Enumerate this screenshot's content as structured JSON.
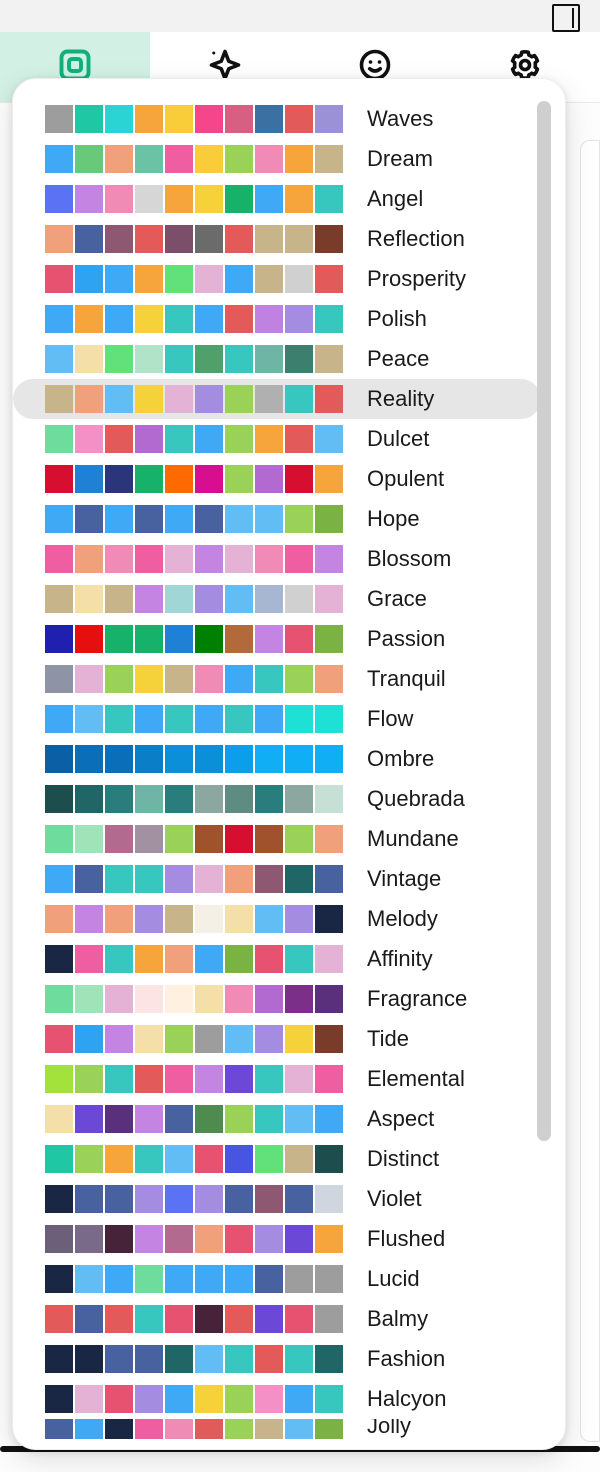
{
  "selected_palette": "Reality",
  "palettes": [
    {
      "name": "Waves",
      "colors": [
        "#9d9d9d",
        "#1fc7a4",
        "#2ad4d4",
        "#f6a53c",
        "#f9cc3a",
        "#f5458b",
        "#d65f82",
        "#3b70a3",
        "#e25a5a",
        "#9b91d6"
      ]
    },
    {
      "name": "Dream",
      "colors": [
        "#3fa9f5",
        "#67c979",
        "#f0a07a",
        "#6bc3a6",
        "#ee5ea0",
        "#f9cc3a",
        "#9ad159",
        "#f08bb5",
        "#f6a53c",
        "#c7b48b"
      ]
    },
    {
      "name": "Angel",
      "colors": [
        "#5b72f5",
        "#c485e2",
        "#f08bb5",
        "#d6d6d6",
        "#f6a53c",
        "#f5d23a",
        "#17b26a",
        "#3fa9f5",
        "#f6a53c",
        "#37c7bf"
      ]
    },
    {
      "name": "Reflection",
      "colors": [
        "#f0a07a",
        "#47629e",
        "#8e5772",
        "#e25a5a",
        "#7b4f6a",
        "#6b6b6b",
        "#e25a5a",
        "#c7b48b",
        "#c7b48b",
        "#7a3c2a"
      ]
    },
    {
      "name": "Prosperity",
      "colors": [
        "#e65270",
        "#2ea3f2",
        "#3fa9f5",
        "#f6a53c",
        "#62e07a",
        "#e4b2d5",
        "#3fa9f5",
        "#c7b48b",
        "#d0d0d0",
        "#e25a5a"
      ]
    },
    {
      "name": "Polish",
      "colors": [
        "#3fa9f5",
        "#f6a53c",
        "#3fa9f5",
        "#f5d23a",
        "#37c7bf",
        "#3fa9f5",
        "#e25a5a",
        "#c082e0",
        "#a48de0",
        "#37c7bf"
      ]
    },
    {
      "name": "Peace",
      "colors": [
        "#62bdf5",
        "#f5dfa8",
        "#62e07a",
        "#b1e3c9",
        "#37c7bf",
        "#4fa06b",
        "#37c7bf",
        "#6fb5a6",
        "#3d7f6f",
        "#c7b48b"
      ]
    },
    {
      "name": "Reality",
      "colors": [
        "#c7b48b",
        "#f0a07a",
        "#62bdf5",
        "#f5d23a",
        "#e4b2d5",
        "#a48de0",
        "#9ad159",
        "#b0b0b0",
        "#37c7bf",
        "#e25a5a"
      ]
    },
    {
      "name": "Dulcet",
      "colors": [
        "#6edc9c",
        "#f590c7",
        "#e25a5a",
        "#b26ad1",
        "#37c7bf",
        "#3fa9f5",
        "#9ad159",
        "#f6a53c",
        "#e25a5a",
        "#62bdf5"
      ]
    },
    {
      "name": "Opulent",
      "colors": [
        "#d60e2f",
        "#1f81d6",
        "#2b357a",
        "#17b26a",
        "#ff6a00",
        "#d60e8f",
        "#9ad159",
        "#b26ad1",
        "#d60e2f",
        "#f6a53c"
      ]
    },
    {
      "name": "Hope",
      "colors": [
        "#3fa9f5",
        "#47629e",
        "#3fa9f5",
        "#47629e",
        "#3fa9f5",
        "#47629e",
        "#62bdf5",
        "#62bdf5",
        "#9ad159",
        "#7ab344"
      ]
    },
    {
      "name": "Blossom",
      "colors": [
        "#ee5ea0",
        "#f0a07a",
        "#f08bb5",
        "#ee5ea0",
        "#e4b2d5",
        "#c485e2",
        "#e4b2d5",
        "#f08bb5",
        "#ee5ea0",
        "#c485e2"
      ]
    },
    {
      "name": "Grace",
      "colors": [
        "#c7b48b",
        "#f5dfa8",
        "#c7b48b",
        "#c485e2",
        "#a0d6d6",
        "#a48de0",
        "#62bdf5",
        "#a7b6d1",
        "#d0d0d0",
        "#e4b2d5"
      ]
    },
    {
      "name": "Passion",
      "colors": [
        "#1f1fb0",
        "#e60e0e",
        "#17b26a",
        "#17b26a",
        "#1f81d6",
        "#008000",
        "#b26a3c",
        "#c485e2",
        "#e65270",
        "#7ab344"
      ]
    },
    {
      "name": "Tranquil",
      "colors": [
        "#8e94a6",
        "#e4b2d5",
        "#9ad159",
        "#f5d23a",
        "#c7b48b",
        "#f08bb5",
        "#3fa9f5",
        "#37c7bf",
        "#9ad159",
        "#f0a07a"
      ]
    },
    {
      "name": "Flow",
      "colors": [
        "#3fa9f5",
        "#62bdf5",
        "#37c7bf",
        "#3fa9f5",
        "#37c7bf",
        "#3fa9f5",
        "#37c7bf",
        "#3fa9f5",
        "#1fe0d5",
        "#1fe0d5"
      ]
    },
    {
      "name": "Ombre",
      "colors": [
        "#0a5fa5",
        "#0a6fb8",
        "#0a6fb8",
        "#0a7fc8",
        "#0a8fd8",
        "#0a8fd8",
        "#0a9fe8",
        "#10aef5",
        "#10aef5",
        "#10aef5"
      ]
    },
    {
      "name": "Quebrada",
      "colors": [
        "#1d4d4d",
        "#216666",
        "#2a7d7d",
        "#6fb5a6",
        "#2a7d7d",
        "#8ba7a0",
        "#5e8b82",
        "#2a7d7d",
        "#8ba7a0",
        "#c6e0d6"
      ]
    },
    {
      "name": "Mundane",
      "colors": [
        "#6edc9c",
        "#a0e3b8",
        "#b26a8e",
        "#a291a0",
        "#9ad159",
        "#a0522d",
        "#d60e2f",
        "#a0522d",
        "#9ad159",
        "#f0a07a"
      ]
    },
    {
      "name": "Vintage",
      "colors": [
        "#3fa9f5",
        "#47629e",
        "#37c7bf",
        "#37c7bf",
        "#a48de0",
        "#e4b2d5",
        "#f0a07a",
        "#8e5772",
        "#216666",
        "#47629e"
      ]
    },
    {
      "name": "Melody",
      "colors": [
        "#f0a07a",
        "#c485e2",
        "#f0a07a",
        "#a48de0",
        "#c7b48b",
        "#f5f0e6",
        "#f5dfa8",
        "#62bdf5",
        "#a48de0",
        "#1a2744"
      ]
    },
    {
      "name": "Affinity",
      "colors": [
        "#1a2744",
        "#ee5ea0",
        "#37c7bf",
        "#f6a53c",
        "#f0a07a",
        "#3fa9f5",
        "#7ab344",
        "#e65270",
        "#37c7bf",
        "#e4b2d5"
      ]
    },
    {
      "name": "Fragrance",
      "colors": [
        "#6edc9c",
        "#a0e3b8",
        "#e4b2d5",
        "#fde4e4",
        "#fff0e0",
        "#f5dfa8",
        "#f08bb5",
        "#b26ad1",
        "#7b2f88",
        "#5a2f7b"
      ]
    },
    {
      "name": "Tide",
      "colors": [
        "#e65270",
        "#2ea3f2",
        "#c485e2",
        "#f5dfa8",
        "#9ad159",
        "#9d9d9d",
        "#62bdf5",
        "#a48de0",
        "#f5d23a",
        "#7a3c2a"
      ]
    },
    {
      "name": "Elemental",
      "colors": [
        "#a3e23a",
        "#9ad159",
        "#37c7bf",
        "#e25a5a",
        "#ee5ea0",
        "#c485e2",
        "#6b48d6",
        "#37c7bf",
        "#e4b2d5",
        "#ee5ea0"
      ]
    },
    {
      "name": "Aspect",
      "colors": [
        "#f5dfa8",
        "#6b48d6",
        "#5a2f7b",
        "#c485e2",
        "#47629e",
        "#4f8a4f",
        "#9ad159",
        "#37c7bf",
        "#62bdf5",
        "#3fa9f5"
      ]
    },
    {
      "name": "Distinct",
      "colors": [
        "#1fc7a4",
        "#9ad159",
        "#f6a53c",
        "#37c7bf",
        "#62bdf5",
        "#e65270",
        "#4854e2",
        "#62e07a",
        "#c7b48b",
        "#1d4d4d"
      ]
    },
    {
      "name": "Violet",
      "colors": [
        "#1a2744",
        "#47629e",
        "#47629e",
        "#a48de0",
        "#5b72f5",
        "#a48de0",
        "#47629e",
        "#8e5772",
        "#47629e",
        "#d0d6e0"
      ]
    },
    {
      "name": "Flushed",
      "colors": [
        "#6b5f7a",
        "#7a6a8a",
        "#47233a",
        "#c485e2",
        "#b26a8e",
        "#f0a07a",
        "#e65270",
        "#a48de0",
        "#6b48d6",
        "#f6a53c"
      ]
    },
    {
      "name": "Lucid",
      "colors": [
        "#1a2744",
        "#62bdf5",
        "#3fa9f5",
        "#6edc9c",
        "#3fa9f5",
        "#3fa9f5",
        "#3fa9f5",
        "#47629e",
        "#9d9d9d",
        "#9d9d9d"
      ]
    },
    {
      "name": "Balmy",
      "colors": [
        "#e25a5a",
        "#47629e",
        "#e25a5a",
        "#37c7bf",
        "#e65270",
        "#47233a",
        "#e25a5a",
        "#6b48d6",
        "#e65270",
        "#9d9d9d"
      ]
    },
    {
      "name": "Fashion",
      "colors": [
        "#1a2744",
        "#1a2744",
        "#47629e",
        "#47629e",
        "#216666",
        "#62bdf5",
        "#37c7bf",
        "#e25a5a",
        "#37c7bf",
        "#216666"
      ]
    },
    {
      "name": "Halcyon",
      "colors": [
        "#1a2744",
        "#e4b2d5",
        "#e65270",
        "#a48de0",
        "#3fa9f5",
        "#f5d23a",
        "#9ad159",
        "#f590c7",
        "#3fa9f5",
        "#37c7bf"
      ]
    },
    {
      "name": "Jolly",
      "colors": [
        "#47629e",
        "#3fa9f5",
        "#1a2744",
        "#ee5ea0",
        "#f08bb5",
        "#e25a5a",
        "#9ad159",
        "#c7b48b",
        "#62bdf5",
        "#7ab344"
      ],
      "partial": true
    }
  ]
}
